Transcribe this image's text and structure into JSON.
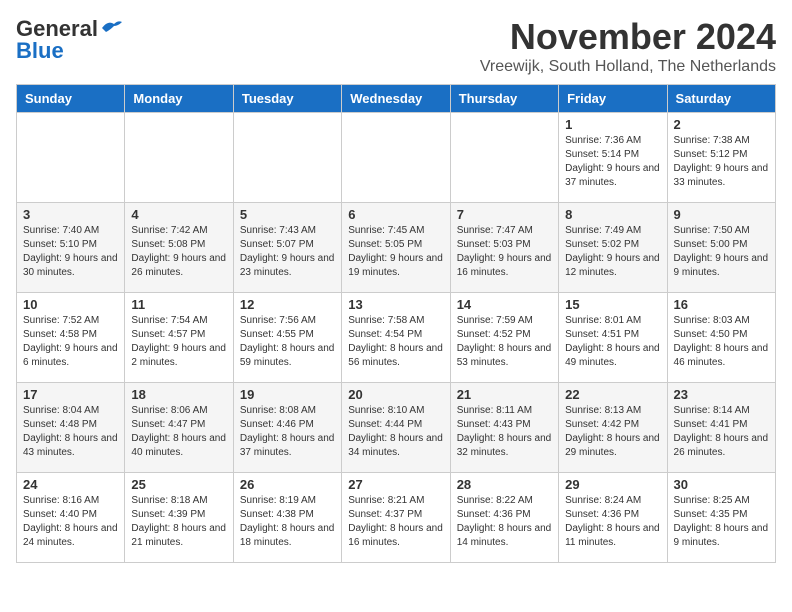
{
  "header": {
    "logo_general": "General",
    "logo_blue": "Blue",
    "month_title": "November 2024",
    "location": "Vreewijk, South Holland, The Netherlands"
  },
  "weekdays": [
    "Sunday",
    "Monday",
    "Tuesday",
    "Wednesday",
    "Thursday",
    "Friday",
    "Saturday"
  ],
  "weeks": [
    [
      {
        "day": "",
        "sunrise": "",
        "sunset": "",
        "daylight": ""
      },
      {
        "day": "",
        "sunrise": "",
        "sunset": "",
        "daylight": ""
      },
      {
        "day": "",
        "sunrise": "",
        "sunset": "",
        "daylight": ""
      },
      {
        "day": "",
        "sunrise": "",
        "sunset": "",
        "daylight": ""
      },
      {
        "day": "",
        "sunrise": "",
        "sunset": "",
        "daylight": ""
      },
      {
        "day": "1",
        "sunrise": "Sunrise: 7:36 AM",
        "sunset": "Sunset: 5:14 PM",
        "daylight": "Daylight: 9 hours and 37 minutes."
      },
      {
        "day": "2",
        "sunrise": "Sunrise: 7:38 AM",
        "sunset": "Sunset: 5:12 PM",
        "daylight": "Daylight: 9 hours and 33 minutes."
      }
    ],
    [
      {
        "day": "3",
        "sunrise": "Sunrise: 7:40 AM",
        "sunset": "Sunset: 5:10 PM",
        "daylight": "Daylight: 9 hours and 30 minutes."
      },
      {
        "day": "4",
        "sunrise": "Sunrise: 7:42 AM",
        "sunset": "Sunset: 5:08 PM",
        "daylight": "Daylight: 9 hours and 26 minutes."
      },
      {
        "day": "5",
        "sunrise": "Sunrise: 7:43 AM",
        "sunset": "Sunset: 5:07 PM",
        "daylight": "Daylight: 9 hours and 23 minutes."
      },
      {
        "day": "6",
        "sunrise": "Sunrise: 7:45 AM",
        "sunset": "Sunset: 5:05 PM",
        "daylight": "Daylight: 9 hours and 19 minutes."
      },
      {
        "day": "7",
        "sunrise": "Sunrise: 7:47 AM",
        "sunset": "Sunset: 5:03 PM",
        "daylight": "Daylight: 9 hours and 16 minutes."
      },
      {
        "day": "8",
        "sunrise": "Sunrise: 7:49 AM",
        "sunset": "Sunset: 5:02 PM",
        "daylight": "Daylight: 9 hours and 12 minutes."
      },
      {
        "day": "9",
        "sunrise": "Sunrise: 7:50 AM",
        "sunset": "Sunset: 5:00 PM",
        "daylight": "Daylight: 9 hours and 9 minutes."
      }
    ],
    [
      {
        "day": "10",
        "sunrise": "Sunrise: 7:52 AM",
        "sunset": "Sunset: 4:58 PM",
        "daylight": "Daylight: 9 hours and 6 minutes."
      },
      {
        "day": "11",
        "sunrise": "Sunrise: 7:54 AM",
        "sunset": "Sunset: 4:57 PM",
        "daylight": "Daylight: 9 hours and 2 minutes."
      },
      {
        "day": "12",
        "sunrise": "Sunrise: 7:56 AM",
        "sunset": "Sunset: 4:55 PM",
        "daylight": "Daylight: 8 hours and 59 minutes."
      },
      {
        "day": "13",
        "sunrise": "Sunrise: 7:58 AM",
        "sunset": "Sunset: 4:54 PM",
        "daylight": "Daylight: 8 hours and 56 minutes."
      },
      {
        "day": "14",
        "sunrise": "Sunrise: 7:59 AM",
        "sunset": "Sunset: 4:52 PM",
        "daylight": "Daylight: 8 hours and 53 minutes."
      },
      {
        "day": "15",
        "sunrise": "Sunrise: 8:01 AM",
        "sunset": "Sunset: 4:51 PM",
        "daylight": "Daylight: 8 hours and 49 minutes."
      },
      {
        "day": "16",
        "sunrise": "Sunrise: 8:03 AM",
        "sunset": "Sunset: 4:50 PM",
        "daylight": "Daylight: 8 hours and 46 minutes."
      }
    ],
    [
      {
        "day": "17",
        "sunrise": "Sunrise: 8:04 AM",
        "sunset": "Sunset: 4:48 PM",
        "daylight": "Daylight: 8 hours and 43 minutes."
      },
      {
        "day": "18",
        "sunrise": "Sunrise: 8:06 AM",
        "sunset": "Sunset: 4:47 PM",
        "daylight": "Daylight: 8 hours and 40 minutes."
      },
      {
        "day": "19",
        "sunrise": "Sunrise: 8:08 AM",
        "sunset": "Sunset: 4:46 PM",
        "daylight": "Daylight: 8 hours and 37 minutes."
      },
      {
        "day": "20",
        "sunrise": "Sunrise: 8:10 AM",
        "sunset": "Sunset: 4:44 PM",
        "daylight": "Daylight: 8 hours and 34 minutes."
      },
      {
        "day": "21",
        "sunrise": "Sunrise: 8:11 AM",
        "sunset": "Sunset: 4:43 PM",
        "daylight": "Daylight: 8 hours and 32 minutes."
      },
      {
        "day": "22",
        "sunrise": "Sunrise: 8:13 AM",
        "sunset": "Sunset: 4:42 PM",
        "daylight": "Daylight: 8 hours and 29 minutes."
      },
      {
        "day": "23",
        "sunrise": "Sunrise: 8:14 AM",
        "sunset": "Sunset: 4:41 PM",
        "daylight": "Daylight: 8 hours and 26 minutes."
      }
    ],
    [
      {
        "day": "24",
        "sunrise": "Sunrise: 8:16 AM",
        "sunset": "Sunset: 4:40 PM",
        "daylight": "Daylight: 8 hours and 24 minutes."
      },
      {
        "day": "25",
        "sunrise": "Sunrise: 8:18 AM",
        "sunset": "Sunset: 4:39 PM",
        "daylight": "Daylight: 8 hours and 21 minutes."
      },
      {
        "day": "26",
        "sunrise": "Sunrise: 8:19 AM",
        "sunset": "Sunset: 4:38 PM",
        "daylight": "Daylight: 8 hours and 18 minutes."
      },
      {
        "day": "27",
        "sunrise": "Sunrise: 8:21 AM",
        "sunset": "Sunset: 4:37 PM",
        "daylight": "Daylight: 8 hours and 16 minutes."
      },
      {
        "day": "28",
        "sunrise": "Sunrise: 8:22 AM",
        "sunset": "Sunset: 4:36 PM",
        "daylight": "Daylight: 8 hours and 14 minutes."
      },
      {
        "day": "29",
        "sunrise": "Sunrise: 8:24 AM",
        "sunset": "Sunset: 4:36 PM",
        "daylight": "Daylight: 8 hours and 11 minutes."
      },
      {
        "day": "30",
        "sunrise": "Sunrise: 8:25 AM",
        "sunset": "Sunset: 4:35 PM",
        "daylight": "Daylight: 8 hours and 9 minutes."
      }
    ]
  ]
}
